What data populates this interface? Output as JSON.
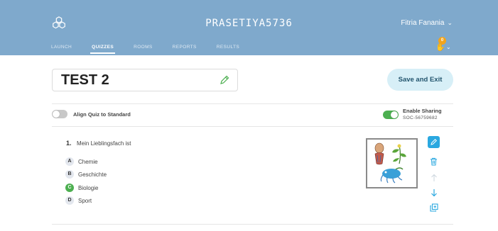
{
  "header": {
    "room_name": "PRASETIYA5736",
    "user_name": "Fitria Fanania",
    "notification_count": "0",
    "nav": [
      "LAUNCH",
      "QUIZZES",
      "ROOMS",
      "REPORTS",
      "RESULTS"
    ],
    "active_nav": "QUIZZES",
    "bar_color": "#7fa9cc"
  },
  "quiz": {
    "title": "TEST 2",
    "save_label": "Save and Exit",
    "align_label": "Align Quiz to Standard",
    "align_enabled": false,
    "sharing_label": "Enable Sharing",
    "sharing_enabled": true,
    "share_code": "SOC-56759682"
  },
  "question": {
    "number": "1.",
    "text": "Mein Lieblingsfach ist",
    "answers": [
      {
        "letter": "A",
        "text": "Chemie",
        "correct": false
      },
      {
        "letter": "B",
        "text": "Geschichte",
        "correct": false
      },
      {
        "letter": "C",
        "text": "Biologie",
        "correct": true
      },
      {
        "letter": "D",
        "text": "Sport",
        "correct": false
      }
    ]
  },
  "colors": {
    "accent": "#2aa8e0",
    "correct": "#4caf50",
    "save_button_bg": "#d7eff7"
  }
}
